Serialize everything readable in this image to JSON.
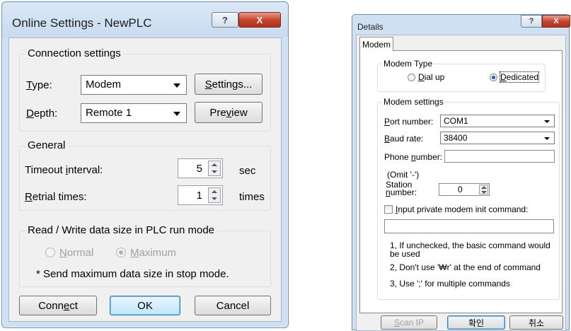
{
  "online_settings": {
    "title": "Online Settings - NewPLC",
    "help_glyph": "?",
    "close_glyph": "X",
    "connection": {
      "group_title": "Connection settings",
      "type_label_u": "T",
      "type_label_rest": "ype:",
      "type_value": "Modem",
      "settings_button_u": "S",
      "settings_button_rest": "ettings...",
      "depth_label_u": "D",
      "depth_label_rest": "epth:",
      "depth_value": "Remote 1",
      "preview_button_pre": "Pre",
      "preview_button_u": "v",
      "preview_button_post": "iew"
    },
    "general": {
      "group_title": "General",
      "timeout_label_pre": "Timeout ",
      "timeout_label_u": "i",
      "timeout_label_post": "nterval:",
      "timeout_value": "5",
      "timeout_unit": "sec",
      "retrial_label_u": "R",
      "retrial_label_post": "etrial times:",
      "retrial_value": "1",
      "retrial_unit": "times"
    },
    "read_write": {
      "group_title": "Read / Write data size in PLC run mode",
      "normal_u": "N",
      "normal_rest": "ormal",
      "maximum_u": "M",
      "maximum_rest": "aximum",
      "note": "* Send maximum data size in stop mode."
    },
    "buttons": {
      "connect_pre": "Conn",
      "connect_u": "e",
      "connect_post": "ct",
      "ok": "OK",
      "cancel": "Cancel"
    }
  },
  "details": {
    "title": "Details",
    "help_glyph": "?",
    "close_glyph": "X",
    "tab_label": "Modem",
    "modem_type": {
      "group_title": "Modem Type",
      "dialup_u": "D",
      "dialup_rest": "ial up",
      "dedicated_u": "D",
      "dedicated_rest": "edicated"
    },
    "modem_settings": {
      "group_title": "Modem settings",
      "port_label_u": "P",
      "port_label_rest": "ort number:",
      "port_value": "COM1",
      "baud_label_u": "B",
      "baud_label_rest": "aud rate:",
      "baud_value": "38400",
      "phone_label_pre": "Phone ",
      "phone_label_u": "n",
      "phone_label_post": "umber:",
      "omit_note": "(Omit '-')",
      "station_label_line1": "Station",
      "station_label_line2_u": "n",
      "station_label_line2_rest": "umber:",
      "station_value": "0"
    },
    "init_command": {
      "label_u": "I",
      "label_rest": "nput private modem init command:",
      "note1": "1, If unchecked, the basic command would be used",
      "note2": "2, Don't use '₩r' at the end of command",
      "note3": "3, Use ';' for multiple commands"
    },
    "buttons": {
      "scanip_u": "S",
      "scanip_rest": "can IP",
      "ok": "확인",
      "cancel": "취소"
    }
  }
}
